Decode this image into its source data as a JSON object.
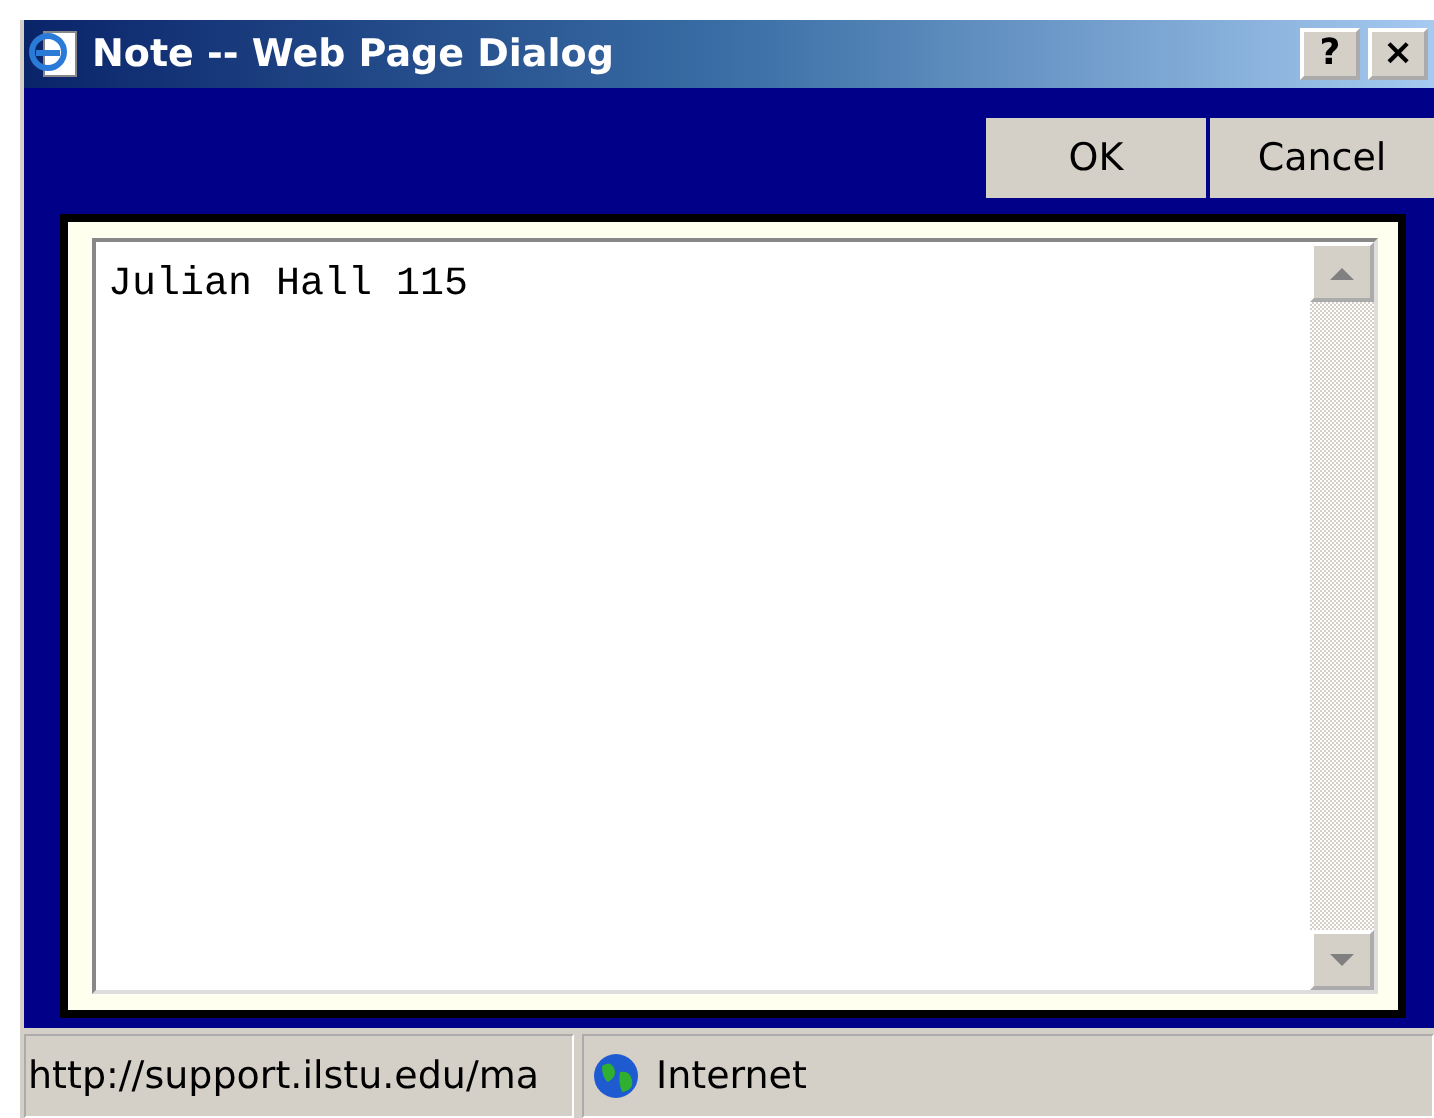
{
  "window": {
    "title": "Note -- Web Page Dialog",
    "help_button": "?",
    "close_button": "×"
  },
  "buttons": [
    {
      "label": "OK"
    },
    {
      "label": "Cancel"
    }
  ],
  "note": {
    "value": "Julian Hall 115"
  },
  "status_bar": {
    "url": "http://support.ilstu.edu/ma",
    "zone": "Internet"
  }
}
